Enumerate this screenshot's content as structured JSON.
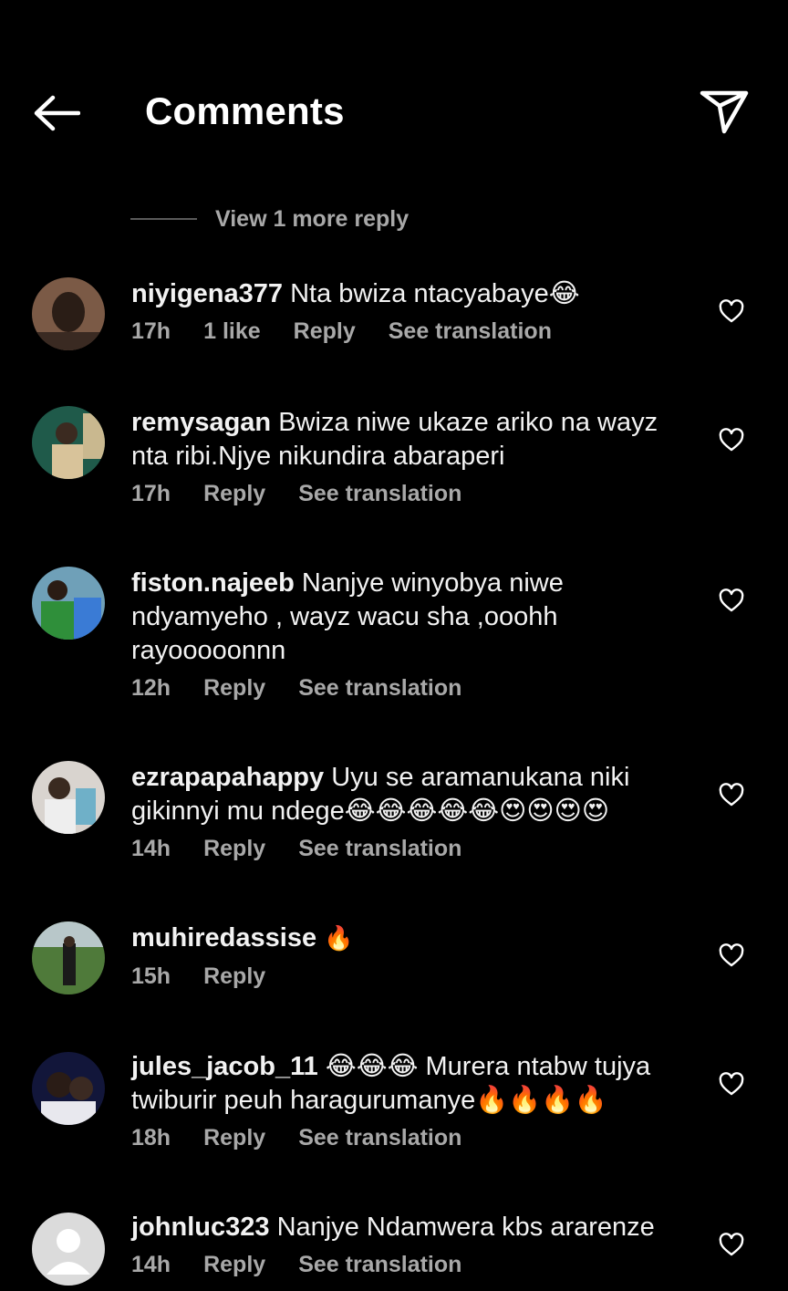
{
  "header": {
    "title": "Comments",
    "back_icon": "arrow-left-icon",
    "send_icon": "paper-plane-icon"
  },
  "view_more": {
    "label": "View 1 more reply"
  },
  "colors": {
    "background": "#000000",
    "text": "#ffffff",
    "secondary": "#a8a8a8"
  },
  "comments": [
    {
      "username": "niyigena377",
      "text": "Nta bwiza ntacyabaye😂",
      "time": "17h",
      "likes": "1 like",
      "reply": "Reply",
      "translation": "See translation"
    },
    {
      "username": "remysagan",
      "text": "Bwiza niwe ukaze ariko na wayz nta ribi.Njye nikundira abaraperi",
      "time": "17h",
      "reply": "Reply",
      "translation": "See translation"
    },
    {
      "username": "fiston.najeeb",
      "text": "Nanjye winyobya niwe ndyamyeho , wayz wacu sha ,ooohh rayooooonnn",
      "time": "12h",
      "reply": "Reply",
      "translation": "See translation"
    },
    {
      "username": "ezrapapahappy",
      "text": "Uyu se aramanukana niki gikinnyi mu ndege😂😂😂😂😂😍😍😍😍",
      "time": "14h",
      "reply": "Reply",
      "translation": "See translation"
    },
    {
      "username": "muhiredassise",
      "text": "🔥",
      "time": "15h",
      "reply": "Reply"
    },
    {
      "username": "jules_jacob_11",
      "text": "😂😂😂 Murera ntabw tujya twiburir peuh haragurumanye🔥🔥🔥🔥",
      "time": "18h",
      "reply": "Reply",
      "translation": "See translation"
    },
    {
      "username": "johnluc323",
      "text": "Nanjye Ndamwera kbs ararenze",
      "time": "14h",
      "reply": "Reply",
      "translation": "See translation"
    }
  ]
}
